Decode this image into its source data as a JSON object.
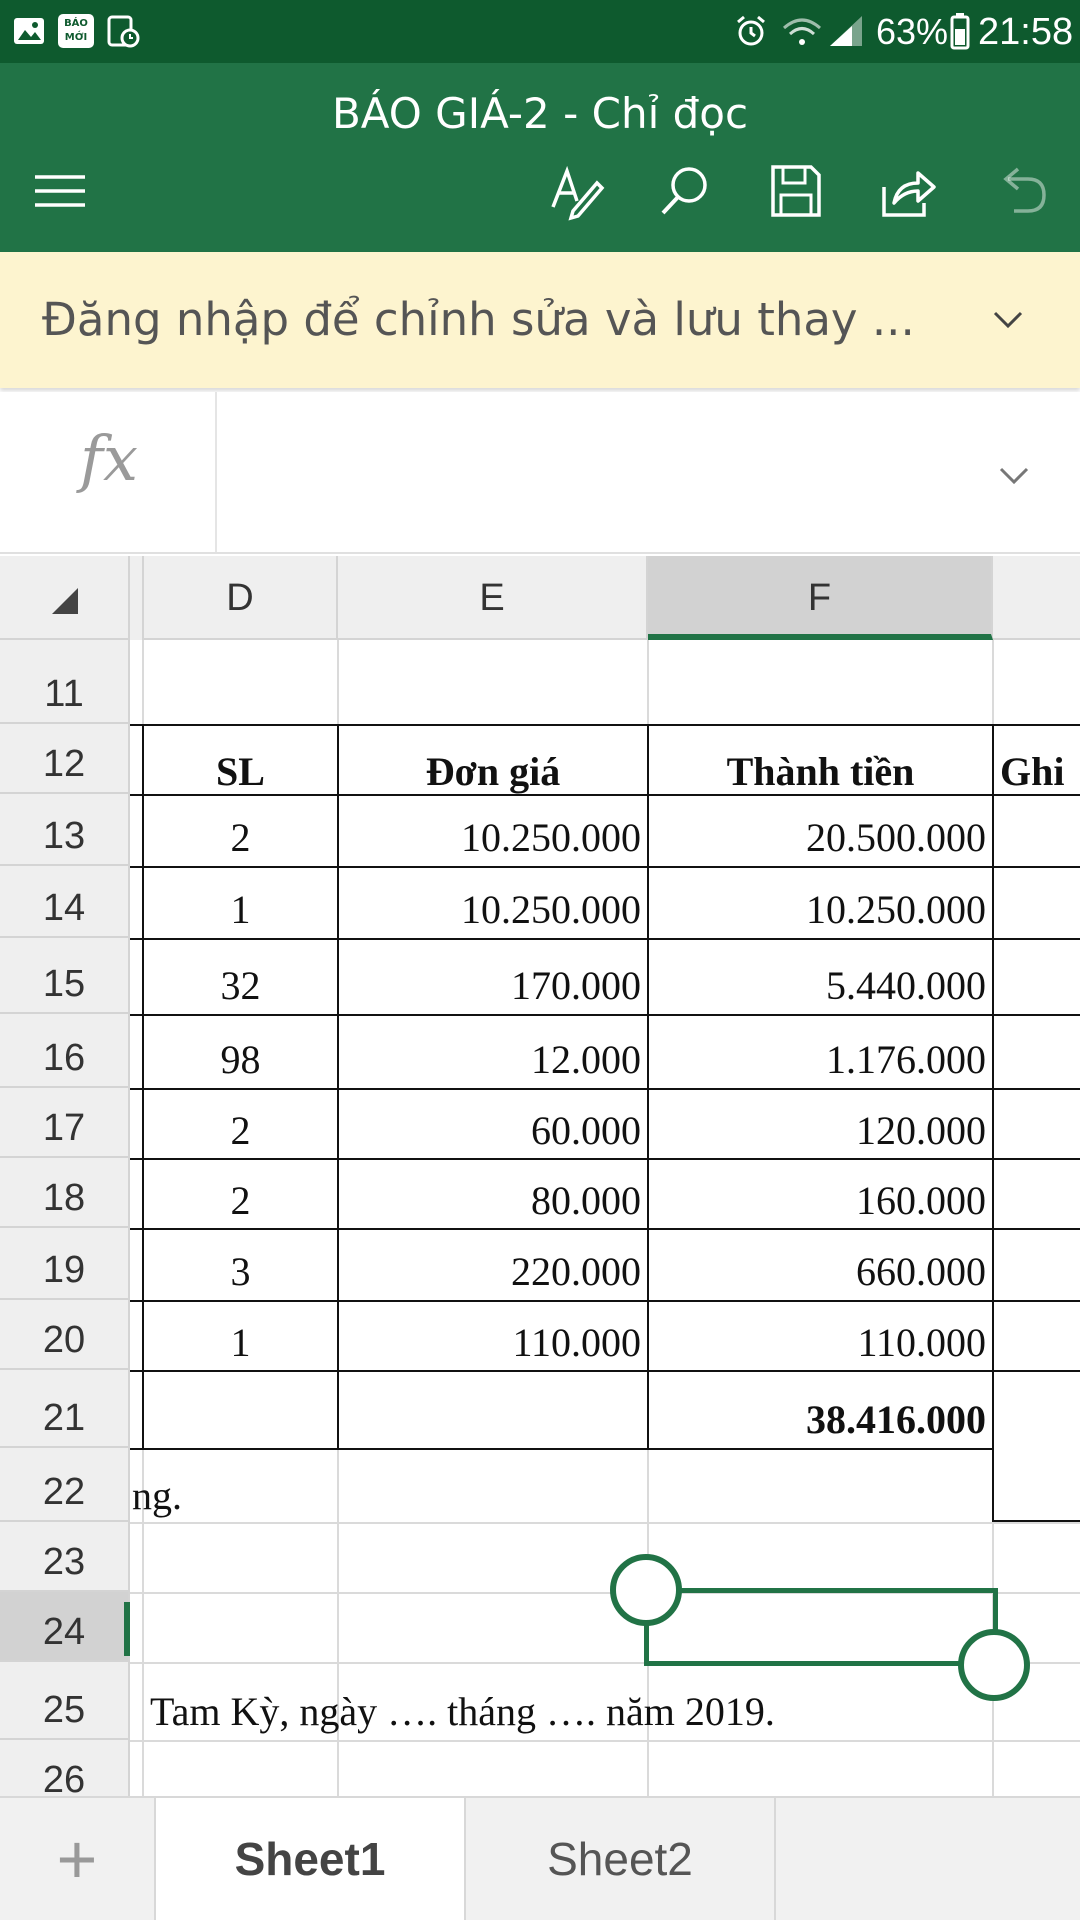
{
  "status_bar": {
    "battery": "63%",
    "time": "21:58",
    "icons": [
      "gallery-icon",
      "baomoi-app-icon",
      "usage-timer-icon",
      "alarm-icon",
      "wifi-icon",
      "signal-icon",
      "battery-icon"
    ],
    "baomoi_text_top": "BÁO",
    "baomoi_text_bottom": "MỚI"
  },
  "app_bar": {
    "title": "BÁO GIÁ-2 - Chỉ đọc",
    "actions": [
      "menu-icon",
      "draw-pen-icon",
      "search-icon",
      "save-icon",
      "share-icon",
      "undo-icon"
    ]
  },
  "banner": {
    "text": "Đăng nhập để chỉnh sửa và lưu thay ...",
    "chevron": "chevron-down-icon"
  },
  "formula_bar": {
    "label": "fx",
    "value": ""
  },
  "grid": {
    "columns": [
      "D",
      "E",
      "F"
    ],
    "active_column": "F",
    "rows": [
      "11",
      "12",
      "13",
      "14",
      "15",
      "16",
      "17",
      "18",
      "19",
      "20",
      "21",
      "22",
      "23",
      "24",
      "25",
      "26"
    ],
    "active_row": "24",
    "header_row": {
      "sl": "SL",
      "don_gia": "Đơn giá",
      "thanh_tien": "Thành tiền",
      "ghi_chu": "Ghi"
    },
    "data_rows": [
      {
        "sl": "2",
        "don_gia": "10.250.000",
        "thanh_tien": "20.500.000"
      },
      {
        "sl": "1",
        "don_gia": "10.250.000",
        "thanh_tien": "10.250.000"
      },
      {
        "sl": "32",
        "don_gia": "170.000",
        "thanh_tien": "5.440.000"
      },
      {
        "sl": "98",
        "don_gia": "12.000",
        "thanh_tien": "1.176.000"
      },
      {
        "sl": "2",
        "don_gia": "60.000",
        "thanh_tien": "120.000"
      },
      {
        "sl": "2",
        "don_gia": "80.000",
        "thanh_tien": "160.000"
      },
      {
        "sl": "3",
        "don_gia": "220.000",
        "thanh_tien": "660.000"
      },
      {
        "sl": "1",
        "don_gia": "110.000",
        "thanh_tien": "110.000"
      }
    ],
    "total": "38.416.000",
    "row22_text": "ng.",
    "row25_text": "Tam Kỳ, ngày …. tháng …. năm 2019."
  },
  "sheets": {
    "add_label": "+",
    "tabs": [
      "Sheet1",
      "Sheet2"
    ],
    "active": "Sheet1"
  },
  "colors": {
    "status_bar": "#0e5a2e",
    "app_bar": "#217346",
    "banner": "#fdf4cf",
    "accent": "#217346"
  }
}
